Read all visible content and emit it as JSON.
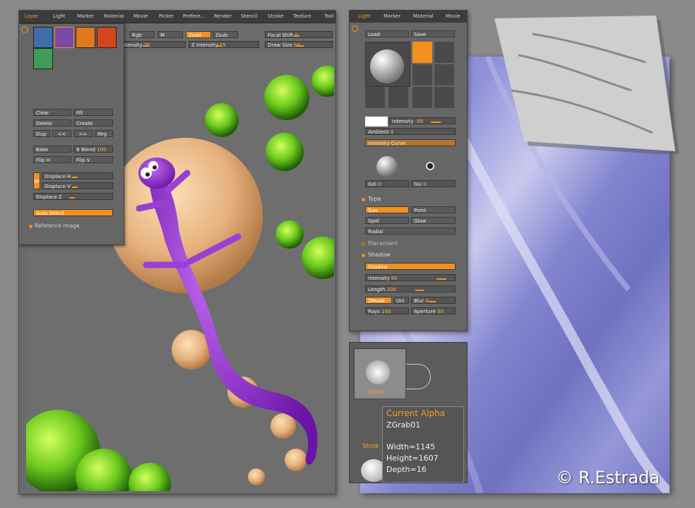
{
  "left_window": {
    "menu": [
      "Layer",
      "Light",
      "Marker",
      "Material",
      "Movie",
      "Picker",
      "Prefere...",
      "Render",
      "Stencil",
      "Stroke",
      "Texture",
      "Tool"
    ],
    "toolbar": {
      "rgb": "Rgb",
      "m": "M",
      "zadd": "Zadd",
      "zsub": "Zsub",
      "focal_shift_label": "Focal Shift",
      "focal_shift_value": "0",
      "intensity_label": "Intensity",
      "intensity_value": "25",
      "z_intensity_label": "Z Intensity",
      "z_intensity_value": "25",
      "draw_size_label": "Draw Size",
      "draw_size_value": "64"
    }
  },
  "layer_palette": {
    "buttons": {
      "clear": "Clear",
      "fill": "Fill",
      "delete": "Delete",
      "create": "Create",
      "dup": "Dup",
      "prev": "<<",
      "next": ">>",
      "mrg": "Mrg",
      "bake": "Bake",
      "b_blend_label": "B Blend",
      "b_blend_value": "100",
      "flip_h": "Flip H",
      "flip_v": "Flip V"
    },
    "w_label": "W",
    "displace_h": "Displace H",
    "displace_v": "Displace V",
    "displace_z": "Displace Z",
    "auto_select": "Auto Select",
    "reference_image": "Reference Image"
  },
  "light_palette": {
    "tabs": [
      "Light",
      "Marker",
      "Material",
      "Movie"
    ],
    "load": "Load",
    "save": "Save",
    "intensity_label": "Intensity",
    "intensity_value": ".99",
    "ambient_label": "Ambient",
    "ambient_value": "4",
    "intensity_curve": "Intensity Curve",
    "gdi_label": "Gdi",
    "gdi_value": "0",
    "gsi_label": "Gsi",
    "gsi_value": "0",
    "type_section": "Type",
    "sun": "Sun",
    "point": "Point",
    "spot": "Spot",
    "glow": "Glow",
    "radial": "Radial",
    "placement_section": "Placement",
    "shadow_section": "Shadow",
    "shadow_button": "Shadow",
    "shadow_intensity_label": "Intensity",
    "shadow_intensity_value": "80",
    "length_label": "Length",
    "length_value": "200",
    "zmode": "ZMode",
    "uni": "Uni",
    "blur_label": "Blur",
    "blur_value": "4",
    "rays_label": "Rays",
    "rays_value": "100",
    "aperture_label": "Aperture",
    "aperture_value": "30"
  },
  "alpha_palette": {
    "alpha_label": "Alpha",
    "stroke_label": "Strok"
  },
  "tooltip": {
    "title": "Current Alpha",
    "name": "ZGrab01",
    "width": "Width=1145",
    "height": "Height=1607",
    "depth": "Depth=16"
  },
  "watermark": "© R.Estrada",
  "colors": {
    "accent": "#f2901f",
    "background": "#8a8a8a",
    "panel": "#666666",
    "texture": "#8688d2"
  }
}
